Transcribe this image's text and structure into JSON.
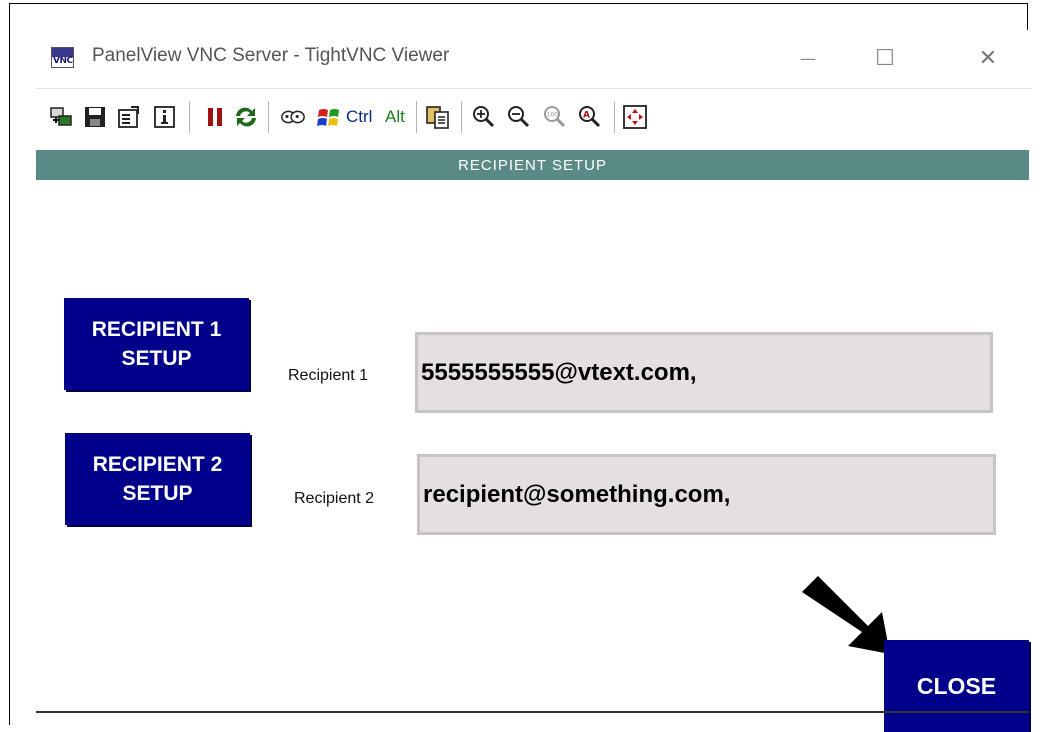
{
  "window": {
    "title": "PanelView VNC Server - TightVNC Viewer",
    "icon_text": "VNC",
    "controls": {
      "minimize": "—",
      "maximize": "☐",
      "close": "✕"
    }
  },
  "toolbar": {
    "ctrl_label": "Ctrl",
    "alt_label": "Alt",
    "icons": [
      "new-connection-icon",
      "save-icon",
      "options-icon",
      "info-icon",
      "pause-icon",
      "refresh-icon",
      "ctrl-alt-del-icon",
      "win-key-icon",
      "ctrl-key",
      "alt-key",
      "clipboard-icon",
      "zoom-in-icon",
      "zoom-out-icon",
      "zoom-100-icon",
      "zoom-auto-icon",
      "fullscreen-icon"
    ]
  },
  "screen": {
    "header": "RECIPIENT SETUP",
    "recipient1": {
      "button_line1": "RECIPIENT 1",
      "button_line2": "SETUP",
      "label": "Recipient 1",
      "value": "5555555555@vtext.com,"
    },
    "recipient2": {
      "button_line1": "RECIPIENT 2",
      "button_line2": "SETUP",
      "label": "Recipient 2",
      "value": "recipient@something.com,"
    },
    "close_label": "CLOSE"
  },
  "colors": {
    "header_band": "#5a8a86",
    "button_blue": "#00008b",
    "field_bg": "#e5dfe0"
  }
}
